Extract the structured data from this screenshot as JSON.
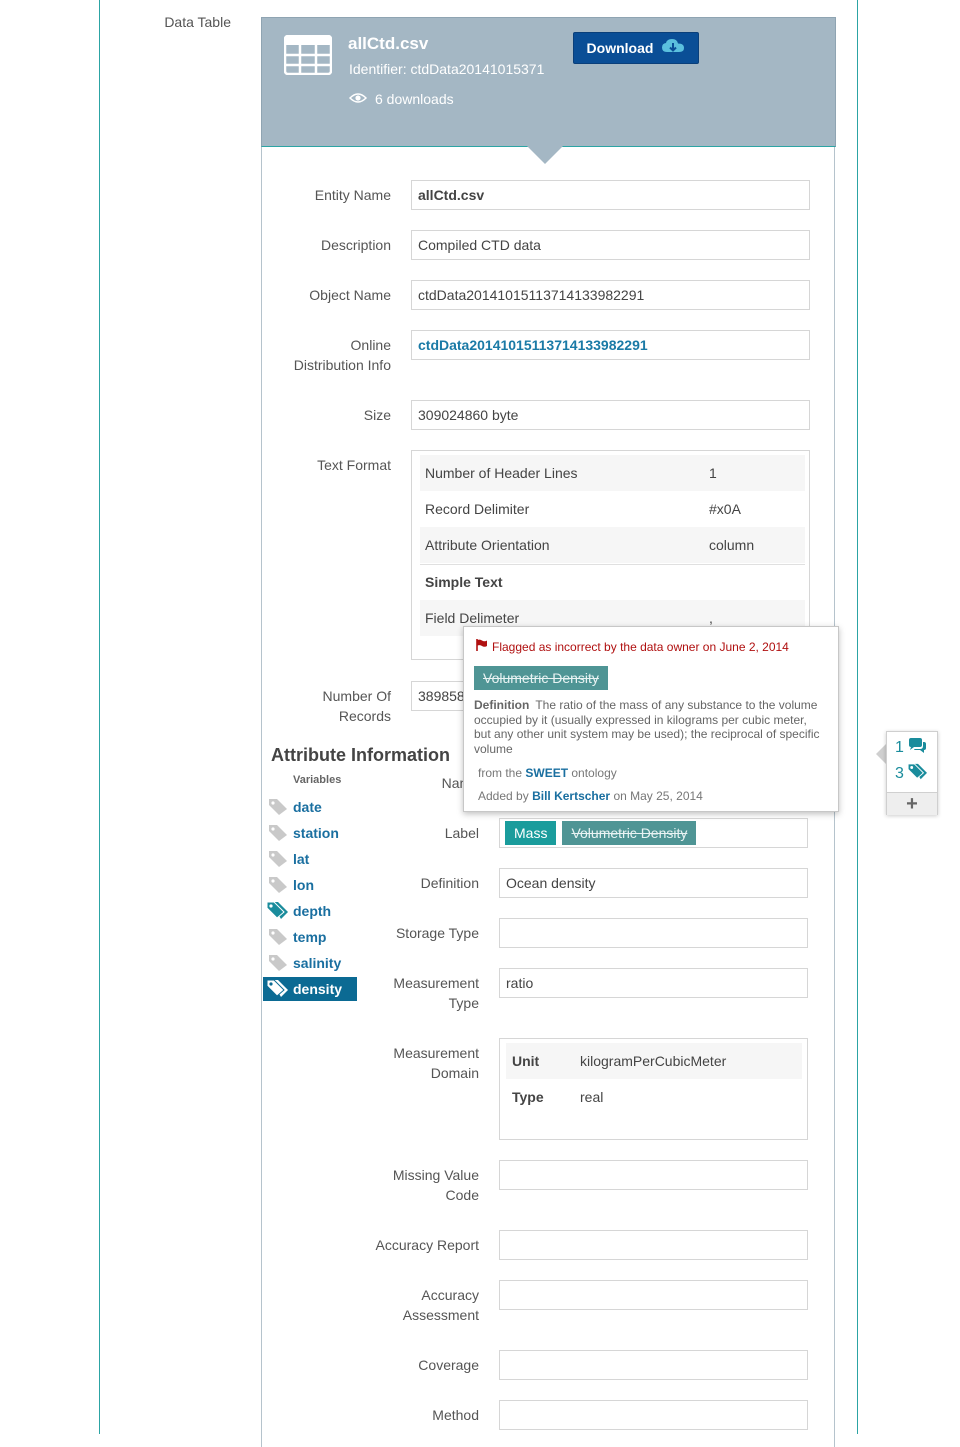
{
  "section_label": "Data Table",
  "header": {
    "file_name": "allCtd.csv",
    "identifier": "Identifier: ctdData20141015371",
    "downloads": "6 downloads",
    "download_label": "Download"
  },
  "fields": {
    "entity_name": {
      "label": "Entity Name",
      "value": "allCtd.csv"
    },
    "description": {
      "label": "Description",
      "value": "Compiled CTD data"
    },
    "object_name": {
      "label": "Object Name",
      "value": "ctdData20141015113714133982291"
    },
    "online_dist": {
      "label_1": "Online",
      "label_2": "Distribution Info",
      "value": "ctdData20141015113714133982291"
    },
    "size": {
      "label": "Size",
      "value": "309024860 byte"
    },
    "text_format": {
      "label": "Text Format"
    },
    "num_records": {
      "label_1": "Number Of",
      "label_2": "Records",
      "value": "389858"
    }
  },
  "text_format": {
    "rows": [
      {
        "key": "Number of Header Lines",
        "value": "1"
      },
      {
        "key": "Record Delimiter",
        "value": "#x0A"
      },
      {
        "key": "Attribute Orientation",
        "value": "column"
      }
    ],
    "simple_text": "Simple Text",
    "field_delimiter": {
      "key": "Field Delimeter",
      "value": ","
    }
  },
  "attribute_info": {
    "title": "Attribute Information",
    "variables_header": "Variables",
    "variables": [
      "date",
      "station",
      "lat",
      "lon",
      "depth",
      "temp",
      "salinity",
      "density"
    ],
    "selected": "density"
  },
  "attr_fields": {
    "name_label": "Name",
    "label": {
      "label": "Label",
      "chips": [
        "Mass",
        "Volumetric Density"
      ]
    },
    "definition": {
      "label": "Definition",
      "value": "Ocean density"
    },
    "storage_type": {
      "label": "Storage Type",
      "value": ""
    },
    "measurement_type": {
      "label_1": "Measurement",
      "label_2": "Type",
      "value": "ratio"
    },
    "measurement_domain": {
      "label_1": "Measurement",
      "label_2": "Domain",
      "rows": [
        {
          "key": "Unit",
          "value": "kilogramPerCubicMeter"
        },
        {
          "key": "Type",
          "value": "real"
        }
      ]
    },
    "missing_value": {
      "label_1": "Missing Value",
      "label_2": "Code",
      "value": ""
    },
    "accuracy_report": {
      "label": "Accuracy Report",
      "value": ""
    },
    "accuracy_assessment": {
      "label_1": "Accuracy",
      "label_2": "Assessment",
      "value": ""
    },
    "coverage": {
      "label": "Coverage",
      "value": ""
    },
    "method": {
      "label": "Method",
      "value": ""
    }
  },
  "popover": {
    "flag_text": "Flagged as incorrect by the data owner on June 2, 2014",
    "chip": "Volumetric Density",
    "definition_label": "Definition",
    "definition_text": "The ratio of the mass of any substance to the volume occupied by it (usually expressed in kilograms per cubic meter, but any other unit system may be used); the reciprocal of specific volume",
    "source_prefix": "from the",
    "source_name": "SWEET",
    "source_suffix": "ontology",
    "added_prefix": "Added by",
    "added_by": "Bill Kertscher",
    "added_suffix": "on May 25, 2014"
  },
  "side_widget": {
    "comments_count": "1",
    "tags_count": "3",
    "add_symbol": "+"
  },
  "colors": {
    "accent": "#2ca4a4",
    "header_bg": "#a4b7c4",
    "download_btn": "#0a4e96",
    "selected_var": "#0b6a93",
    "flag": "#b01010"
  }
}
